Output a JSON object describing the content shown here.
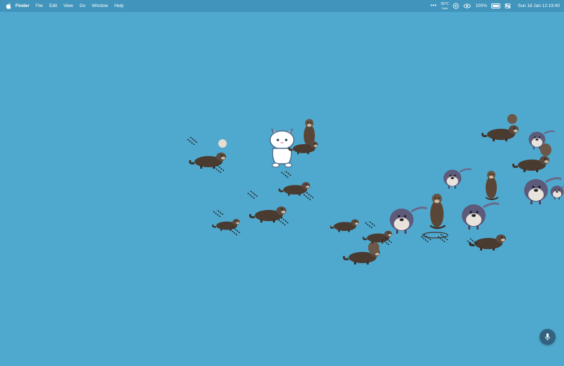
{
  "menubar": {
    "app_name": "Finder",
    "items": [
      "File",
      "Edit",
      "View",
      "Go",
      "Window",
      "Help"
    ],
    "weather_temp": "60°C",
    "weather_sub": "0rpm",
    "battery_percent": "100%",
    "battery_level": 1.0,
    "datetime": "Sun 18 Jan  12:19:40"
  },
  "desktop": {
    "background_color": "#4fa9cf",
    "icons": {
      "otter": "otter-sticker",
      "cat": "cat-mascot",
      "mic": "microphone-icon"
    }
  }
}
